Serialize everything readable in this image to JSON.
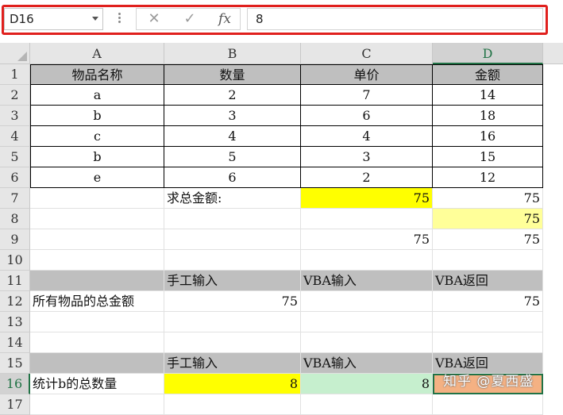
{
  "formula_bar": {
    "name_box": "D16",
    "cancel_icon": "✕",
    "enter_icon": "✓",
    "fx_label": "fx",
    "formula_value": "8"
  },
  "columns": [
    "A",
    "B",
    "C",
    "D"
  ],
  "selected_column": "D",
  "rows": [
    "1",
    "2",
    "3",
    "4",
    "5",
    "6",
    "7",
    "8",
    "9",
    "10",
    "11",
    "12",
    "13",
    "14",
    "15",
    "16",
    "17"
  ],
  "selected_row": "16",
  "table": {
    "headers": [
      "物品名称",
      "数量",
      "单价",
      "金额"
    ],
    "rows": [
      [
        "a",
        "2",
        "7",
        "14"
      ],
      [
        "b",
        "3",
        "6",
        "18"
      ],
      [
        "c",
        "4",
        "4",
        "16"
      ],
      [
        "b",
        "5",
        "3",
        "15"
      ],
      [
        "e",
        "6",
        "2",
        "12"
      ]
    ]
  },
  "row7": {
    "label": "求总金额:",
    "c": "75",
    "d": "75"
  },
  "row8": {
    "d": "75"
  },
  "row9": {
    "c": "75",
    "d": "75"
  },
  "row11": {
    "b": "手工输入",
    "c": "VBA输入",
    "d": "VBA返回"
  },
  "row12": {
    "a": "所有物品的总金额",
    "b": "75",
    "d": "75"
  },
  "row15": {
    "b": "手工输入",
    "c": "VBA输入",
    "d": "VBA返回"
  },
  "row16": {
    "a": "统计b的总数量",
    "b": "8",
    "c": "8"
  },
  "watermark": "知乎 @夏西盛",
  "colors": {
    "formula_bar_highlight": "#e0201d",
    "yellow": "#ffff00",
    "light_yellow": "#ffff99",
    "green": "#c6efce",
    "orange": "#f4b183",
    "gray_header": "#bfbfbf",
    "excel_green": "#217346"
  }
}
